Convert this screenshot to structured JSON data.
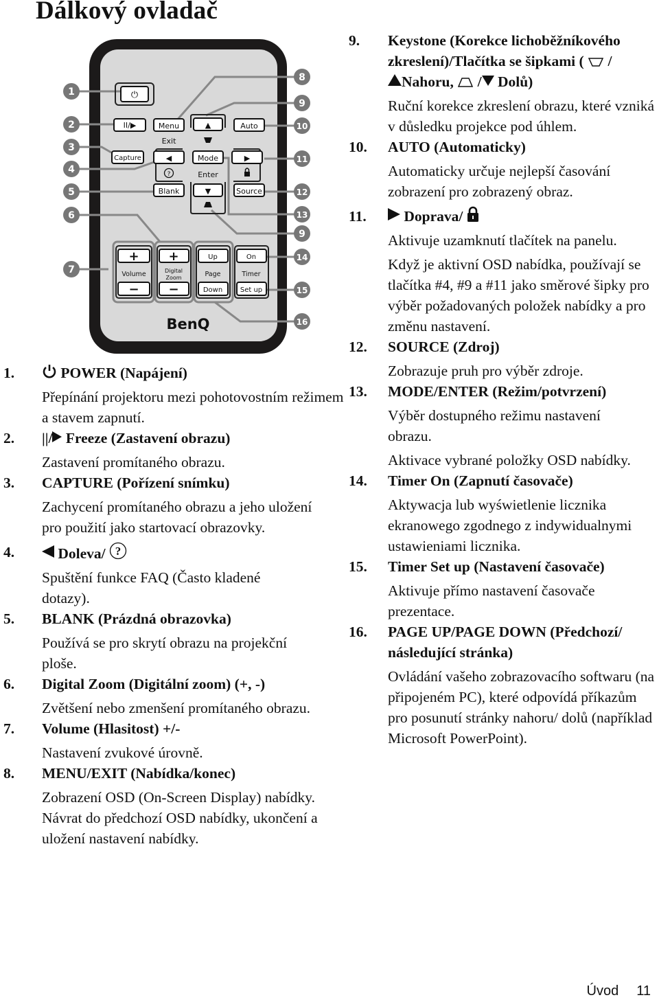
{
  "page": {
    "title": "Dálkový ovladač",
    "footer": {
      "section": "Úvod",
      "page_number": "11"
    }
  },
  "remote": {
    "brand": "BenQ",
    "buttons": {
      "power": "⏻",
      "freeze": "II/▶",
      "menu": "Menu",
      "exit": "Exit",
      "up": "▲",
      "auto": "Auto",
      "capture": "Capture",
      "left": "◀",
      "help": "?",
      "mode": "Mode",
      "enter": "Enter",
      "right": "▶",
      "blank": "Blank",
      "down": "▼",
      "source": "Source",
      "vol_plus": "+",
      "vol_label": "Volume",
      "vol_minus": "−",
      "zoom_plus": "+",
      "zoom_label_1": "Digital",
      "zoom_label_2": "Zoom",
      "zoom_minus": "−",
      "page_up": "Up",
      "page_label": "Page",
      "page_down": "Down",
      "timer_on": "On",
      "timer_label": "Timer",
      "timer_setup": "Set up"
    },
    "callouts": [
      "1",
      "2",
      "3",
      "4",
      "5",
      "6",
      "7",
      "8",
      "9",
      "10",
      "11",
      "12",
      "13",
      "9",
      "14",
      "15",
      "16"
    ]
  },
  "items": [
    {
      "num": "1.",
      "icon": "power-icon",
      "title": "POWER (Napájení)",
      "desc": [
        "Přepínání projektoru mezi pohotovostním režimem a stavem zapnutí."
      ]
    },
    {
      "num": "2.",
      "icon": "freeze-icon",
      "icon_text": "||/",
      "title": "Freeze (Zastavení obrazu)",
      "desc": [
        "Zastavení promítaného obrazu."
      ]
    },
    {
      "num": "3.",
      "title": "CAPTURE (Pořízení snímku)",
      "desc": [
        "Zachycení promítaného obrazu a jeho uložení pro použití jako startovací obrazovky."
      ]
    },
    {
      "num": "4.",
      "icon": "left-arrow-icon",
      "title": "Doleva/",
      "icon2": "help-icon",
      "desc": [
        "Spuštění funkce FAQ (Často kladené dotazy)."
      ]
    },
    {
      "num": "5.",
      "title": "BLANK (Prázdná obrazovka)",
      "desc": [
        "Používá se pro skrytí obrazu na projekční ploše."
      ]
    },
    {
      "num": "6.",
      "title": "Digital Zoom (Digitální zoom) (+, -)",
      "desc": [
        "Zvětšení nebo zmenšení promítaného obrazu."
      ]
    },
    {
      "num": "7.",
      "title": "Volume (Hlasitost) +/-",
      "desc": [
        "Nastavení zvukové úrovně."
      ]
    },
    {
      "num": "8.",
      "title": "MENU/EXIT (Nabídka/konec)",
      "desc": [
        "Zobrazení OSD (On-Screen Display) nabídky. Návrat do předchozí OSD nabídky, ukončení a uložení nastavení nabídky."
      ]
    },
    {
      "num": "9.",
      "title_a": "Keystone (Korekce lichoběžníkového zkreslení)/Tlačítka se šipkami (",
      "title_b": "/",
      "title_c": "Nahoru,",
      "title_d": "/",
      "title_e": "Dolů)",
      "desc": [
        "Ruční korekce zkreslení obrazu, které vzniká v důsledku projekce pod úhlem."
      ]
    },
    {
      "num": "10.",
      "title": "AUTO (Automaticky)",
      "desc": [
        "Automaticky určuje nejlepší časování zobrazení pro zobrazený obraz."
      ]
    },
    {
      "num": "11.",
      "icon": "right-arrow-icon",
      "title": "Doprava/",
      "icon2": "lock-icon",
      "desc": [
        "Aktivuje uzamknutí tlačítek na panelu.",
        "Když je aktivní OSD nabídka, používají se tlačítka  #4, #9 a #11 jako směrové šipky pro výběr požadovaných položek nabídky a pro změnu nastavení."
      ]
    },
    {
      "num": "12.",
      "title": "SOURCE (Zdroj)",
      "desc": [
        "Zobrazuje pruh pro výběr zdroje."
      ]
    },
    {
      "num": "13.",
      "title": "MODE/ENTER (Režim/potvrzení)",
      "desc": [
        "Výběr dostupného režimu nastavení obrazu.",
        "Aktivace vybrané položky OSD nabídky."
      ]
    },
    {
      "num": "14.",
      "title": "Timer On (Zapnutí časovače)",
      "desc": [
        "Aktywacja lub wyświetlenie licznika ekranowego zgodnego z indywidualnymi ustawieniami licznika."
      ]
    },
    {
      "num": "15.",
      "title": "Timer Set up (Nastavení časovače)",
      "desc": [
        "Aktivuje přímo nastavení časovače prezentace."
      ]
    },
    {
      "num": "16.",
      "title": "PAGE UP/PAGE DOWN (Předchozí/ následující stránka)",
      "desc": [
        "Ovládání vašeho zobrazovacího softwaru (na připojeném PC), které odpovídá příkazům pro posunutí stránky nahoru/ dolů (například Microsoft PowerPoint)."
      ]
    }
  ]
}
